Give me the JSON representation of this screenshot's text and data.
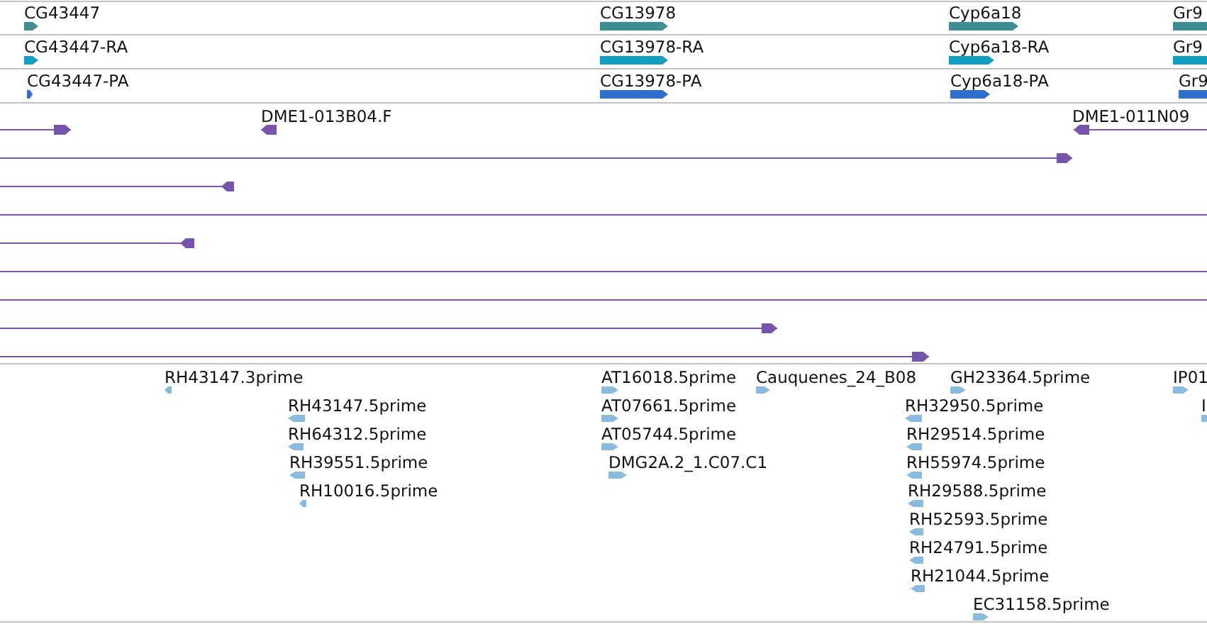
{
  "gene_track": {
    "rows": [
      {
        "kind": "gene",
        "features": [
          {
            "label": "CG43447",
            "reverse": false
          },
          {
            "label": "CG13978",
            "reverse": false
          },
          {
            "label": "Cyp6a18",
            "reverse": false
          },
          {
            "label": "Gr9",
            "reverse": false
          }
        ]
      },
      {
        "kind": "transcript",
        "features": [
          {
            "label": "CG43447-RA",
            "reverse": false
          },
          {
            "label": "CG13978-RA",
            "reverse": false
          },
          {
            "label": "Cyp6a18-RA",
            "reverse": false
          },
          {
            "label": "Gr9",
            "reverse": false
          }
        ]
      },
      {
        "kind": "protein",
        "features": [
          {
            "label": "CG43447-PA",
            "reverse": false
          },
          {
            "label": "CG13978-PA",
            "reverse": false
          },
          {
            "label": "Cyp6a18-PA",
            "reverse": false
          },
          {
            "label": "Gr9",
            "reverse": false
          }
        ]
      }
    ]
  },
  "clone_track": {
    "rows": [
      {
        "kind": "features",
        "features": [
          {
            "reverse": false
          },
          {
            "label": "DME1-013B04.F",
            "reverse": true
          },
          {
            "label": "DME1-011N09",
            "reverse": true
          }
        ]
      },
      {
        "kind": "features",
        "features": [
          {
            "reverse": false
          }
        ]
      },
      {
        "kind": "features",
        "features": [
          {
            "reverse": true
          }
        ]
      },
      {
        "kind": "span"
      },
      {
        "kind": "features",
        "features": [
          {
            "reverse": true
          }
        ]
      },
      {
        "kind": "span"
      },
      {
        "kind": "span"
      },
      {
        "kind": "features",
        "features": [
          {
            "reverse": false
          }
        ]
      },
      {
        "kind": "features",
        "features": [
          {
            "reverse": false
          }
        ]
      }
    ]
  },
  "est_track": {
    "features": [
      {
        "label": "RH43147.3prime",
        "reverse": true
      },
      {
        "label": "RH43147.5prime",
        "reverse": true
      },
      {
        "label": "RH64312.5prime",
        "reverse": true
      },
      {
        "label": "RH39551.5prime",
        "reverse": true
      },
      {
        "label": "RH10016.5prime",
        "reverse": true
      },
      {
        "label": "AT16018.5prime",
        "reverse": false
      },
      {
        "label": "AT07661.5prime",
        "reverse": false
      },
      {
        "label": "AT05744.5prime",
        "reverse": false
      },
      {
        "label": "DMG2A.2_1.C07.C1",
        "reverse": false
      },
      {
        "label": "Cauquenes_24_B08",
        "reverse": false
      },
      {
        "label": "GH23364.5prime",
        "reverse": false
      },
      {
        "label": "RH32950.5prime",
        "reverse": true
      },
      {
        "label": "RH29514.5prime",
        "reverse": true
      },
      {
        "label": "RH55974.5prime",
        "reverse": true
      },
      {
        "label": "RH29588.5prime",
        "reverse": true
      },
      {
        "label": "RH52593.5prime",
        "reverse": true
      },
      {
        "label": "RH24791.5prime",
        "reverse": true
      },
      {
        "label": "RH21044.5prime",
        "reverse": true
      },
      {
        "label": "EC31158.5prime",
        "reverse": false
      },
      {
        "label": "IP01",
        "reverse": false
      },
      {
        "label": "I",
        "reverse": false
      }
    ]
  }
}
